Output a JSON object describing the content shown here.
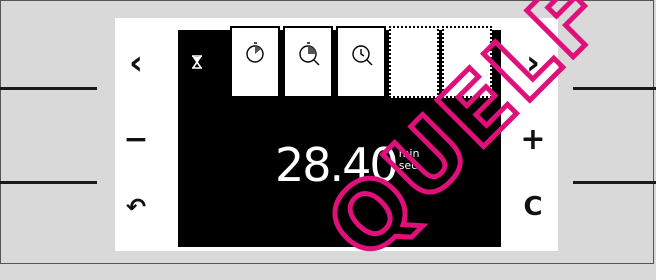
{
  "controls": {
    "prev": "‹",
    "next": "›",
    "minus": "−",
    "plus": "+",
    "back": "↶",
    "clear": "C"
  },
  "display": {
    "time_value": "28.40",
    "unit_top": "min",
    "unit_bottom": "sec"
  },
  "slots": [
    {
      "icon": "timer-partial-icon",
      "state": "filled"
    },
    {
      "icon": "timer-half-icon",
      "state": "filled"
    },
    {
      "icon": "clock-icon",
      "state": "filled"
    },
    {
      "icon": "",
      "state": "empty"
    },
    {
      "icon": "",
      "state": "empty"
    }
  ],
  "watermark": {
    "text": "QUELF",
    "color": "#e0107a"
  },
  "colors": {
    "background": "#d9d9d9",
    "screen": "#000000",
    "panel": "#ffffff",
    "accent": "#e0107a"
  }
}
